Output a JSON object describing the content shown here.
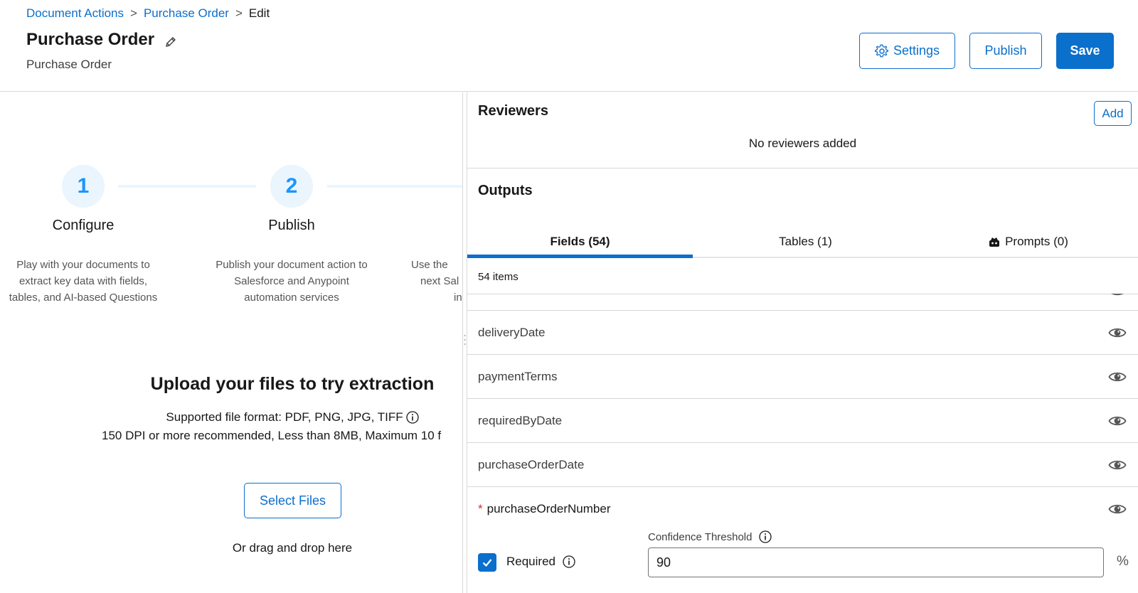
{
  "breadcrumb": {
    "items": [
      "Document Actions",
      "Purchase Order"
    ],
    "current": "Edit",
    "separator": ">"
  },
  "header": {
    "title": "Purchase Order",
    "subtitle": "Purchase Order",
    "settings_label": "Settings",
    "publish_label": "Publish",
    "save_label": "Save"
  },
  "steps": [
    {
      "number": "1",
      "title": "Configure",
      "desc": [
        "Play with your documents to",
        "extract key data with fields,",
        "tables, and AI-based Questions"
      ]
    },
    {
      "number": "2",
      "title": "Publish",
      "desc": [
        "Publish your document action to",
        "Salesforce and Anypoint",
        "automation services"
      ]
    },
    {
      "desc_partial": [
        "Use the",
        "next Sal",
        "in"
      ]
    }
  ],
  "upload": {
    "title": "Upload your files to try extraction",
    "format": "Supported file format: PDF, PNG, JPG, TIFF",
    "dpi": "150 DPI or more recommended, Less than 8MB, Maximum 10 f",
    "select_label": "Select Files",
    "drag_text": "Or drag and drop here"
  },
  "reviewers": {
    "heading": "Reviewers",
    "add_label": "Add",
    "empty_text": "No reviewers added"
  },
  "outputs": {
    "heading": "Outputs",
    "tabs": [
      {
        "label": "Fields (54)",
        "active": true
      },
      {
        "label": "Tables (1)",
        "active": false
      },
      {
        "label": "Prompts (0)",
        "active": false
      }
    ],
    "items_count": "54 items",
    "fields": [
      {
        "name": "deliveryDate",
        "required": false
      },
      {
        "name": "paymentTerms",
        "required": false
      },
      {
        "name": "requiredByDate",
        "required": false
      },
      {
        "name": "purchaseOrderDate",
        "required": false
      },
      {
        "name": "purchaseOrderNumber",
        "required": true
      }
    ],
    "required_star": "*",
    "required_label": "Required",
    "confidence_label": "Confidence Threshold",
    "confidence_value": "90",
    "percent_sign": "%"
  },
  "colors": {
    "brand": "#0b6fcc",
    "step_accent": "#1b96ff",
    "step_bg": "#eaf5fe",
    "required": "#c23934"
  }
}
